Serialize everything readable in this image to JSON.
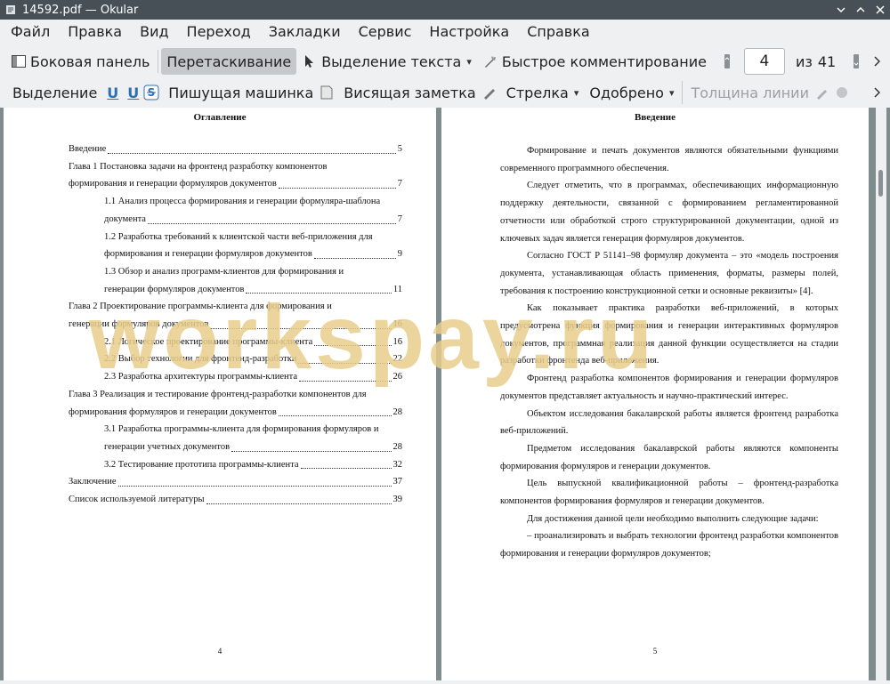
{
  "window": {
    "title": "14592.pdf — Okular"
  },
  "menu": [
    "Файл",
    "Правка",
    "Вид",
    "Переход",
    "Закладки",
    "Сервис",
    "Настройка",
    "Справка"
  ],
  "toolbar1": {
    "sidebar": "Боковая панель",
    "drag": "Перетаскивание",
    "text_select": "Выделение текста",
    "quick_comment": "Быстрое комментирование",
    "page_current": "4",
    "page_of": "из",
    "page_total": "41"
  },
  "toolbar2": {
    "highlight": "Выделение",
    "typewriter": "Пишущая машинка",
    "sticky_note": "Висящая заметка",
    "arrow": "Стрелка",
    "stamp": "Одобрено",
    "line_width": "Толщина линии"
  },
  "watermark": "workspay.ru",
  "left_page": {
    "heading": "Оглавление",
    "number": "4",
    "toc": [
      {
        "text": "Введение",
        "page": "5"
      },
      {
        "text": "Глава 1 Постановка задачи на фронтенд разработку компонентов",
        "page": ""
      },
      {
        "text": "формирования и генерации формуляров документов",
        "page": "7"
      },
      {
        "text": "1.1 Анализ процесса формирования и генерации формуляра-шаблона",
        "page": ""
      },
      {
        "text": "документа",
        "page": "7"
      },
      {
        "text": "1.2 Разработка требований к клиентской части веб-приложения для",
        "page": ""
      },
      {
        "text": "формирования и генерации формуляров документов",
        "page": "9"
      },
      {
        "text": "1.3 Обзор и анализ программ-клиентов для формирования и",
        "page": ""
      },
      {
        "text": "генерации формуляров документов",
        "page": "11"
      },
      {
        "text": "Глава 2 Проектирование программы-клиента для формирования и",
        "page": ""
      },
      {
        "text": "генерации формуляров документов",
        "page": "16"
      },
      {
        "text": "2.1 Логическое проектирование программы-клиента",
        "page": "16"
      },
      {
        "text": "2.2 Выбор технологии для фронтенд-разработки",
        "page": "22"
      },
      {
        "text": "2.3 Разработка архитектуры программы-клиента",
        "page": "26"
      },
      {
        "text": "Глава 3 Реализация и тестирование фронтенд-разработки компонентов для",
        "page": ""
      },
      {
        "text": "формирования формуляров и генерации документов",
        "page": "28"
      },
      {
        "text": "3.1 Разработка программы-клиента для формирования формуляров и",
        "page": ""
      },
      {
        "text": "генерации учетных документов",
        "page": "28"
      },
      {
        "text": "3.2 Тестирование прототипа программы-клиента",
        "page": "32"
      },
      {
        "text": "Заключение",
        "page": "37"
      },
      {
        "text": "Список используемой литературы",
        "page": "39"
      }
    ]
  },
  "right_page": {
    "heading": "Введение",
    "number": "5",
    "paragraphs": [
      "Формирование и печать документов являются обязательными функциями современного программного обеспечения.",
      "Следует отметить, что в программах, обеспечивающих информационную поддержку деятельности, связанной с формированием регламентированной отчетности или обработкой строго структурированной документации, одной из ключевых задач является генерация формуляров документов.",
      "Согласно ГОСТ Р 51141–98 формуляр документа – это «модель построения документа, устанавливающая область применения, форматы, размеры полей, требования к построению конструкционной сетки и основные реквизиты» [4].",
      "Как показывает практика разработки веб-приложений, в которых предусмотрена функция формирования и генерации интерактивных формуляров документов, программная реализация данной функции осуществляется на стадии разработки фронтенда веб-приложения.",
      "Фронтенд разработка компонентов формирования и генерации формуляров документов представляет актуальность и научно-практический интерес.",
      "Объектом исследования бакалаврской работы является фронтенд разработка веб-приложений.",
      "Предметом исследования бакалаврской работы являются компоненты формирования формуляров и генерации документов.",
      "Цель выпускной квалификационной работы – фронтенд-разработка компонентов формирования формуляров и генерации документов.",
      "Для достижения данной цели необходимо выполнить следующие задачи:",
      "– проанализировать и выбрать технологии фронтенд разработки компонентов формирования и генерации формуляров документов;"
    ]
  }
}
